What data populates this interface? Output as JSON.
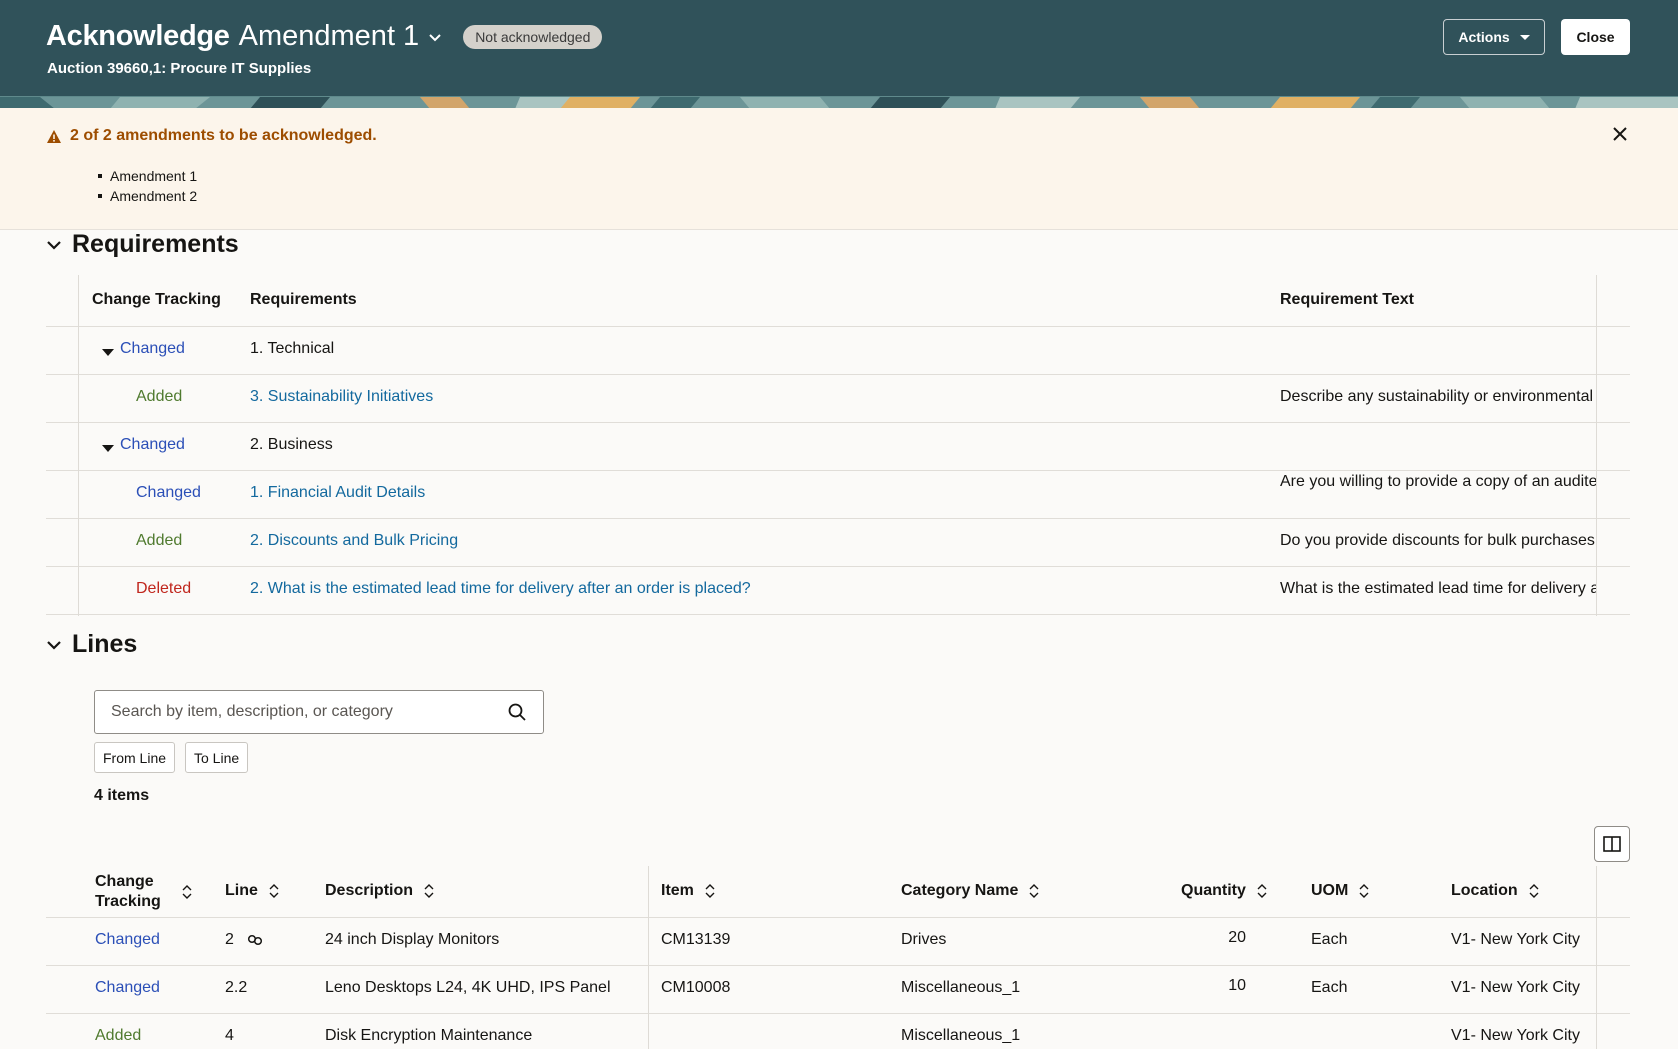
{
  "header": {
    "title_bold": "Acknowledge",
    "title_light": "Amendment 1",
    "status": "Not acknowledged",
    "subtitle": "Auction 39660,1: Procure IT Supplies",
    "actions_label": "Actions",
    "close_label": "Close"
  },
  "warning": {
    "message": "2 of 2 amendments to be acknowledged.",
    "items": [
      "Amendment 1",
      "Amendment 2"
    ]
  },
  "requirements": {
    "title": "Requirements",
    "columns": [
      "Change Tracking",
      "Requirements",
      "Requirement Text"
    ],
    "rows": [
      {
        "change": "Changed",
        "requirement": "1. Technical",
        "text": ""
      },
      {
        "change": "Added",
        "requirement": "3. Sustainability Initiatives",
        "text": "Describe any sustainability or environmental"
      },
      {
        "change": "Changed",
        "requirement": "2. Business",
        "text": ""
      },
      {
        "change": "Changed",
        "requirement": "1. Financial Audit Details",
        "text": "Are you willing to provide a copy of an audite"
      },
      {
        "change": "Added",
        "requirement": "2. Discounts and Bulk Pricing",
        "text": "Do you provide discounts for bulk purchases"
      },
      {
        "change": "Deleted",
        "requirement": "2. What is the estimated lead time for delivery after an order is placed?",
        "text": "What is the estimated lead time for delivery a"
      }
    ]
  },
  "lines": {
    "title": "Lines",
    "search_placeholder": "Search by item, description, or category",
    "from_line": "From Line",
    "to_line": "To Line",
    "items_count": "4 items",
    "columns": {
      "change_1": "Change",
      "change_2": "Tracking",
      "line": "Line",
      "description": "Description",
      "item": "Item",
      "category": "Category Name",
      "quantity": "Quantity",
      "uom": "UOM",
      "location": "Location"
    },
    "rows": [
      {
        "change": "Changed",
        "line": "2",
        "description": "24 inch Display Monitors",
        "item": "CM13139",
        "category": "Drives",
        "quantity": "20",
        "uom": "Each",
        "location": "V1- New York City"
      },
      {
        "change": "Changed",
        "line": "2.2",
        "description": "Leno Desktops L24, 4K UHD, IPS Panel",
        "item": "CM10008",
        "category": "Miscellaneous_1",
        "quantity": "10",
        "uom": "Each",
        "location": "V1- New York City"
      },
      {
        "change": "Added",
        "line": "4",
        "description": "Disk Encryption Maintenance",
        "item": "",
        "category": "Miscellaneous_1",
        "quantity": "",
        "uom": "",
        "location": "V1- New York City"
      }
    ]
  },
  "colors": {
    "header_bg": "#30525a",
    "changed": "#2b4fb7",
    "added": "#4f7a2e",
    "deleted": "#c0261d",
    "link": "#13699e",
    "warning": "#9d4d00"
  }
}
